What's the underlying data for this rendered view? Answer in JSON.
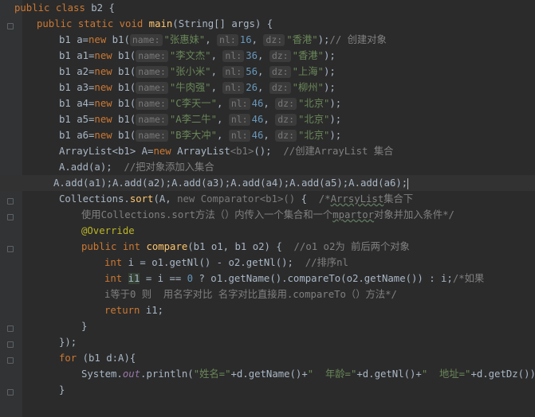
{
  "code": {
    "l1": {
      "kw1": "public",
      "kw2": "class",
      "name": " b2 {"
    },
    "l2": {
      "kw": "public static void ",
      "fn": "main",
      "rest": "(String[] args) {"
    },
    "objects": [
      {
        "var": "b1 a=",
        "hint1": "name:",
        "str1": "\"张惠妹\"",
        "hint2": "nl:",
        "num": "16",
        "hint3": "dz:",
        "str2": "\"香港\"",
        "tail": ");",
        "cmt": "// 创建对象"
      },
      {
        "var": "b1 a1=",
        "hint1": "name:",
        "str1": "\"李文杰\"",
        "hint2": "nl:",
        "num": "36",
        "hint3": "dz:",
        "str2": "\"香港\"",
        "tail": ");",
        "cmt": ""
      },
      {
        "var": "b1 a2=",
        "hint1": "name:",
        "str1": "\"张小米\"",
        "hint2": "nl:",
        "num": "56",
        "hint3": "dz:",
        "str2": "\"上海\"",
        "tail": ");",
        "cmt": ""
      },
      {
        "var": "b1 a3=",
        "hint1": "name:",
        "str1": "\"牛肉强\"",
        "hint2": "nl:",
        "num": "26",
        "hint3": "dz:",
        "str2": "\"柳州\"",
        "tail": ");",
        "cmt": ""
      },
      {
        "var": "b1 a4=",
        "hint1": "name:",
        "str1": "\"C李天一\"",
        "hint2": "nl:",
        "num": "46",
        "hint3": "dz:",
        "str2": "\"北京\"",
        "tail": ");",
        "cmt": ""
      },
      {
        "var": "b1 a5=",
        "hint1": "name:",
        "str1": "\"A李二牛\"",
        "hint2": "nl:",
        "num": "46",
        "hint3": "dz:",
        "str2": "\"北京\"",
        "tail": ");",
        "cmt": ""
      },
      {
        "var": "b1 a6=",
        "hint1": "name:",
        "str1": "\"B李大冲\"",
        "hint2": "nl:",
        "num": "46",
        "hint3": "dz:",
        "str2": "\"北京\"",
        "tail": ");",
        "cmt": ""
      }
    ],
    "new_kw": "new",
    "ctor": " b1(",
    "l10": {
      "a": "ArrayList<b1> A=",
      "kw": "new",
      "b": " ArrayList",
      "gen": "<b1>",
      "c": "();  ",
      "cmt": "//创建ArrayList 集合"
    },
    "l11": {
      "code": "A.add(a);  ",
      "cmt": "//把对象添加入集合"
    },
    "l12": {
      "code": "A.add(a1);A.add(a2);A.add(a3);A.add(a4);A.add(a5);A.add(a6);"
    },
    "l13": {
      "a": "Collections.",
      "sort": "sort",
      "b": "(A, ",
      "new": "new Comparator<b1>()",
      "c": " {  ",
      "cmt1": "/*",
      "cmt2": "ArrsyList",
      "cmt3": "集合下"
    },
    "l14": {
      "cmt1": "使用Collections.sort方法（）内传入一个集合和一个",
      "cmt2": "mpartor",
      "cmt3": "对象并加入条件*/"
    },
    "l15": {
      "ann": "@Override"
    },
    "l16": {
      "kw": "public int ",
      "fn": "compare",
      "rest": "(b1 o1, b1 o2) {  ",
      "cmt": "//o1 o2为 前后两个对象"
    },
    "l17": {
      "kw": "int",
      "rest": " i = o1.getNl() - o2.getNl();  ",
      "cmt": "//排序nl"
    },
    "l18": {
      "kw": "int",
      "sp": " ",
      "var": "i1",
      "a": " = i == ",
      "num": "0",
      "b": " ? o1.getName().compareTo(o2.getName()) : i;",
      "cmt": "/*如果"
    },
    "l19": {
      "cmt": "i等于0 则  用名字对比 名字对比直接用.compareTo（）方法*/"
    },
    "l20": {
      "kw": "return",
      "rest": " i1;"
    },
    "l21": {
      "text": "}"
    },
    "l22": {
      "text": "});"
    },
    "l23": {
      "kw": "for",
      "rest": " (b1 d:A){"
    },
    "l24": {
      "a": "System.",
      "out": "out",
      "b": ".println(",
      "s1": "\"姓名=\"",
      "c": "+d.getName()+",
      "s2": "\"  年龄=\"",
      "d": "+d.getNl()+",
      "s3": "\"  地址=\"",
      "e": "+d.getDz());"
    },
    "l25": {
      "text": "}"
    }
  }
}
